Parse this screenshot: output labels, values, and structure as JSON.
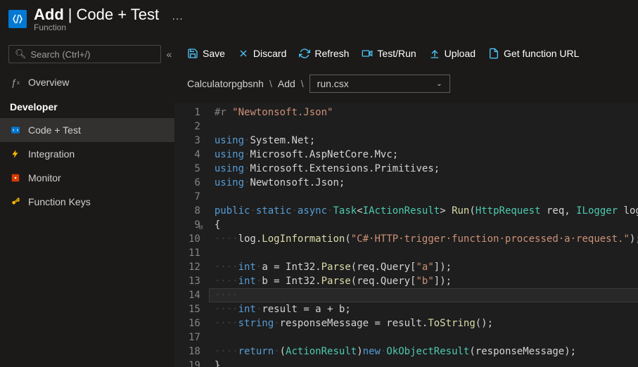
{
  "header": {
    "title_bold": "Add",
    "title_sep": "|",
    "title_rest": "Code + Test",
    "subtitle": "Function"
  },
  "sidebar": {
    "search_placeholder": "Search (Ctrl+/)",
    "overview_label": "Overview",
    "section_label": "Developer",
    "items": [
      {
        "label": "Code + Test"
      },
      {
        "label": "Integration"
      },
      {
        "label": "Monitor"
      },
      {
        "label": "Function Keys"
      }
    ]
  },
  "toolbar": {
    "save": "Save",
    "discard": "Discard",
    "refresh": "Refresh",
    "testrun": "Test/Run",
    "upload": "Upload",
    "geturl": "Get function URL"
  },
  "breadcrumb": {
    "root": "Calculatorpgbsnh",
    "mid": "Add",
    "file": "run.csx"
  },
  "editor": {
    "line_count": 19,
    "code_lines": [
      {
        "n": 1,
        "html": "<span class='tok-dir'>#r</span> <span class='tok-str'>\"Newtonsoft.Json\"</span>"
      },
      {
        "n": 2,
        "html": ""
      },
      {
        "n": 3,
        "html": "<span class='tok-kw'>using</span><span class='tok-ws'>·</span><span class='tok-ns'>System.Net</span>;"
      },
      {
        "n": 4,
        "html": "<span class='tok-kw'>using</span><span class='tok-ws'>·</span><span class='tok-ns'>Microsoft.AspNetCore.Mvc</span>;"
      },
      {
        "n": 5,
        "html": "<span class='tok-kw'>using</span><span class='tok-ws'>·</span><span class='tok-ns'>Microsoft.Extensions.Primitives</span>;"
      },
      {
        "n": 6,
        "html": "<span class='tok-kw'>using</span><span class='tok-ws'>·</span><span class='tok-ns'>Newtonsoft.Json</span>;"
      },
      {
        "n": 7,
        "html": ""
      },
      {
        "n": 8,
        "html": "<span class='tok-kw'>public</span><span class='tok-ws'>·</span><span class='tok-kw'>static</span><span class='tok-ws'>·</span><span class='tok-kw'>async</span><span class='tok-ws'>·</span><span class='tok-type'>Task</span>&lt;<span class='tok-type'>IActionResult</span>&gt; <span class='tok-method'>Run</span>(<span class='tok-type'>HttpRequest</span> req, <span class='tok-type'>ILogger</span> log)"
      },
      {
        "n": 9,
        "html": "{",
        "fold": true
      },
      {
        "n": 10,
        "html": "<span class='tok-ws'>····</span>log.<span class='tok-method'>LogInformation</span>(<span class='tok-str'>\"C#·HTTP·trigger·function·processed·a·request.\"</span>);"
      },
      {
        "n": 11,
        "html": ""
      },
      {
        "n": 12,
        "html": "<span class='tok-ws'>····</span><span class='tok-kw'>int</span><span class='tok-ws'>·</span>a = Int32.<span class='tok-method'>Parse</span>(req.Query[<span class='tok-str'>\"a\"</span>]);"
      },
      {
        "n": 13,
        "html": "<span class='tok-ws'>····</span><span class='tok-kw'>int</span><span class='tok-ws'>·</span>b = Int32.<span class='tok-method'>Parse</span>(req.Query[<span class='tok-str'>\"b\"</span>]);"
      },
      {
        "n": 14,
        "html": "<span class='tok-ws'>····</span>",
        "highlight": true
      },
      {
        "n": 15,
        "html": "<span class='tok-ws'>····</span><span class='tok-kw'>int</span><span class='tok-ws'>·</span>result = a + b;"
      },
      {
        "n": 16,
        "html": "<span class='tok-ws'>····</span><span class='tok-kw'>string</span><span class='tok-ws'>·</span>responseMessage = result.<span class='tok-method'>ToString</span>();"
      },
      {
        "n": 17,
        "html": ""
      },
      {
        "n": 18,
        "html": "<span class='tok-ws'>····</span><span class='tok-kw'>return</span><span class='tok-ws'>·</span>(<span class='tok-type'>ActionResult</span>)<span class='tok-kw'>new</span><span class='tok-ws'>·</span><span class='tok-type'>OkObjectResult</span>(responseMessage);"
      },
      {
        "n": 19,
        "html": "}"
      }
    ]
  }
}
